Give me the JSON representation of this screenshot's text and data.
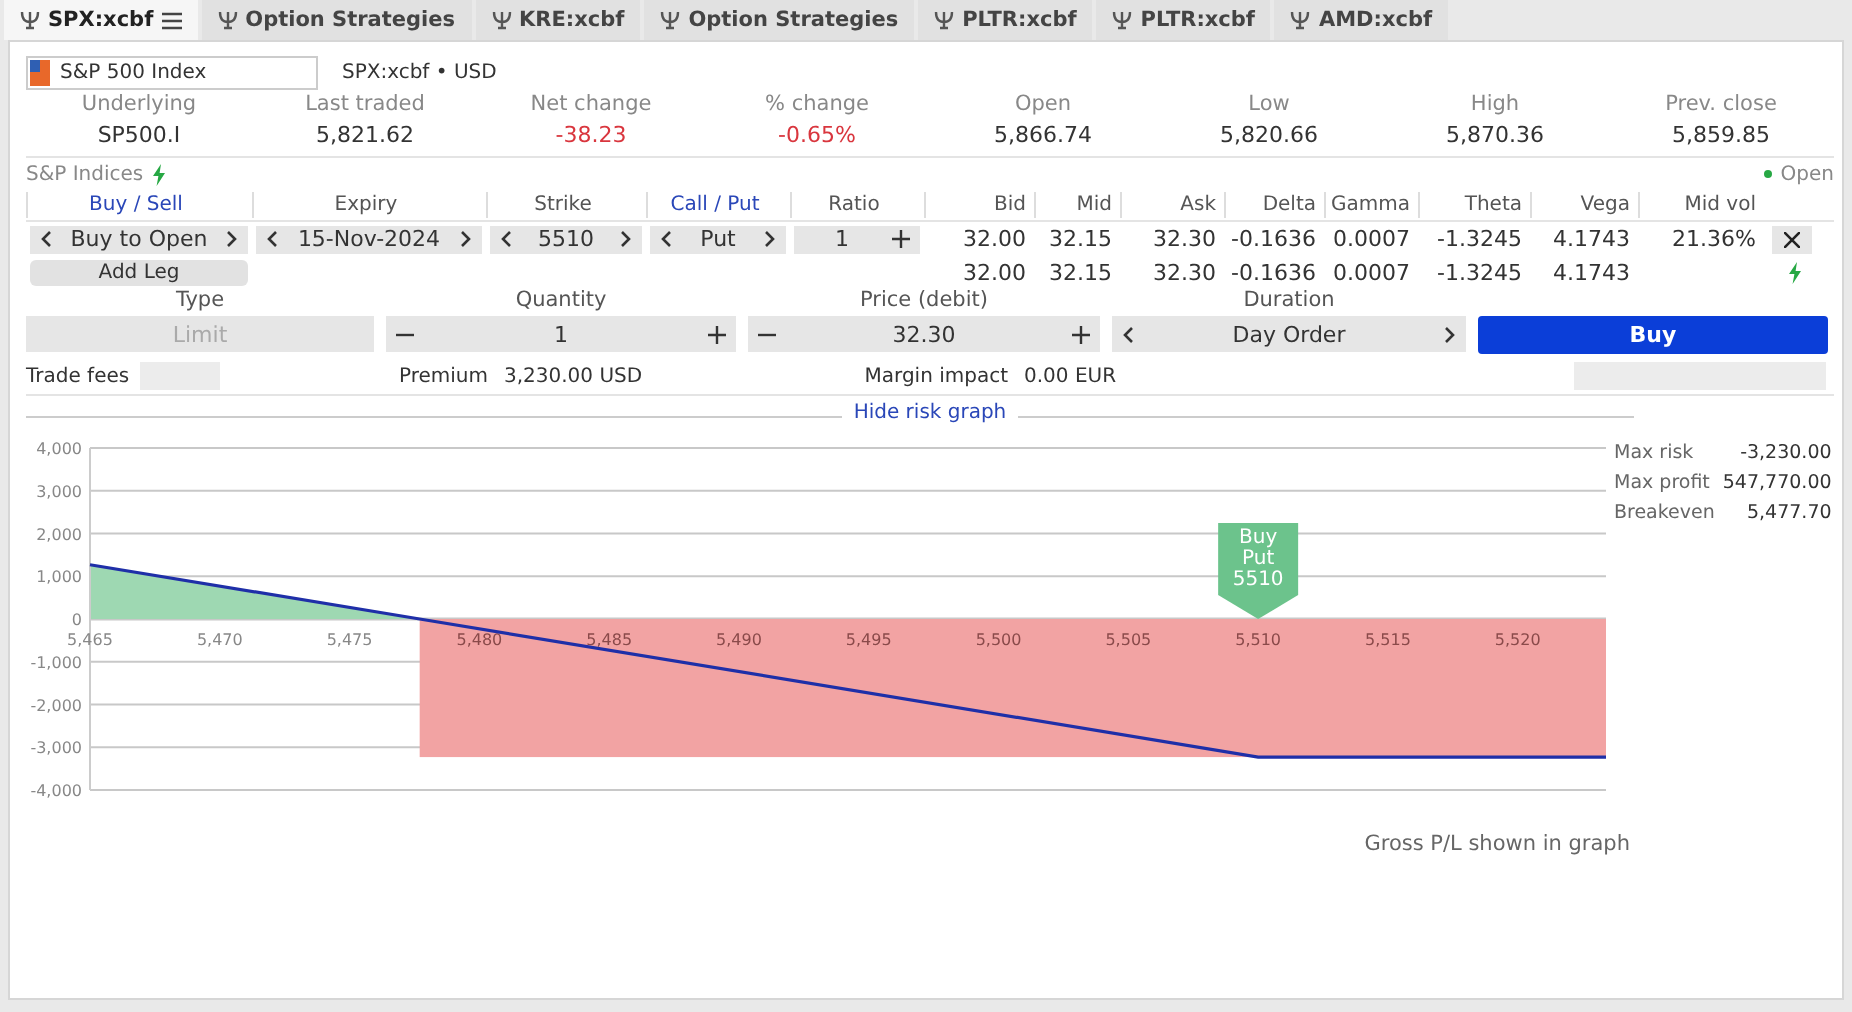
{
  "tabs": [
    {
      "label": "SPX:xcbf",
      "selected": true,
      "menu": true
    },
    {
      "label": "Option Strategies",
      "selected": false,
      "menu": false
    },
    {
      "label": "KRE:xcbf",
      "selected": false,
      "menu": false
    },
    {
      "label": "Option Strategies",
      "selected": false,
      "menu": false
    },
    {
      "label": "PLTR:xcbf",
      "selected": false,
      "menu": false
    },
    {
      "label": "PLTR:xcbf",
      "selected": false,
      "menu": false
    },
    {
      "label": "AMD:xcbf",
      "selected": false,
      "menu": false
    }
  ],
  "instrument": {
    "name": "S&P 500 Index",
    "subtitle": "SPX:xcbf • USD"
  },
  "quote": [
    {
      "label": "Underlying",
      "value": "SP500.I",
      "negative": false
    },
    {
      "label": "Last traded",
      "value": "5,821.62",
      "negative": false
    },
    {
      "label": "Net change",
      "value": "-38.23",
      "negative": true
    },
    {
      "label": "% change",
      "value": "-0.65%",
      "negative": true
    },
    {
      "label": "Open",
      "value": "5,866.74",
      "negative": false
    },
    {
      "label": "Low",
      "value": "5,820.66",
      "negative": false
    },
    {
      "label": "High",
      "value": "5,870.36",
      "negative": false
    },
    {
      "label": "Prev. close",
      "value": "5,859.85",
      "negative": false
    }
  ],
  "market": {
    "group": "S&P Indices",
    "status": "Open"
  },
  "legs_header": [
    {
      "label": "Buy / Sell",
      "kind": "link"
    },
    {
      "label": "Expiry",
      "kind": "plain"
    },
    {
      "label": "Strike",
      "kind": "plain"
    },
    {
      "label": "Call / Put",
      "kind": "link"
    },
    {
      "label": "Ratio",
      "kind": "plain"
    },
    {
      "label": "Bid",
      "kind": "plain"
    },
    {
      "label": "Mid",
      "kind": "plain"
    },
    {
      "label": "Ask",
      "kind": "plain"
    },
    {
      "label": "Delta",
      "kind": "plain"
    },
    {
      "label": "Gamma",
      "kind": "plain"
    },
    {
      "label": "Theta",
      "kind": "plain"
    },
    {
      "label": "Vega",
      "kind": "plain"
    },
    {
      "label": "Mid vol",
      "kind": "plain"
    }
  ],
  "leg": {
    "action": "Buy to Open",
    "expiry": "15-Nov-2024",
    "strike": "5510",
    "right": "Put",
    "ratio": "1",
    "quotes": [
      "32.00",
      "32.15",
      "32.30",
      "-0.1636",
      "0.0007",
      "-1.3245",
      "4.1743",
      "21.36%"
    ]
  },
  "add_leg": "Add Leg",
  "totals": [
    "32.00",
    "32.15",
    "32.30",
    "-0.1636",
    "0.0007",
    "-1.3245",
    "4.1743"
  ],
  "order": {
    "type_label": "Type",
    "type": "Limit",
    "type_disabled": true,
    "quantity_label": "Quantity",
    "quantity": "1",
    "price_label": "Price (debit)",
    "price": "32.30",
    "duration_label": "Duration",
    "duration": "Day Order",
    "submit": "Buy"
  },
  "fees": {
    "trade_fees": "Trade fees",
    "premium_label": "Premium",
    "premium": "3,230.00 USD",
    "margin_label": "Margin impact",
    "margin": "0.00 EUR"
  },
  "hide_graph": "Hide risk graph",
  "risk_graph": {
    "chart_data": {
      "type": "line",
      "grid": true,
      "xlim": [
        5465,
        5523.4
      ],
      "ylim": [
        -4000,
        4000
      ],
      "xticks": [
        {
          "value": 5465,
          "label": "5,465"
        },
        {
          "value": 5470,
          "label": "5,470"
        },
        {
          "value": 5475,
          "label": "5,475"
        },
        {
          "value": 5480,
          "label": "5,480"
        },
        {
          "value": 5485,
          "label": "5,485"
        },
        {
          "value": 5490,
          "label": "5,490"
        },
        {
          "value": 5495,
          "label": "5,495"
        },
        {
          "value": 5500,
          "label": "5,500"
        },
        {
          "value": 5505,
          "label": "5,505"
        },
        {
          "value": 5510,
          "label": "5,510"
        },
        {
          "value": 5515,
          "label": "5,515"
        },
        {
          "value": 5520,
          "label": "5,520"
        }
      ],
      "yticks": [
        {
          "value": 4000,
          "label": "4,000"
        },
        {
          "value": 3000,
          "label": "3,000"
        },
        {
          "value": 2000,
          "label": "2,000"
        },
        {
          "value": 1000,
          "label": "1,000"
        },
        {
          "value": 0,
          "label": "0"
        },
        {
          "value": -1000,
          "label": "-1,000"
        },
        {
          "value": -2000,
          "label": "-2,000"
        },
        {
          "value": -3000,
          "label": "-3,000"
        },
        {
          "value": -4000,
          "label": "-4,000"
        }
      ],
      "x": [
        5465,
        5477.7,
        5510,
        5523.4
      ],
      "series": [
        {
          "color": "#1f2fa8",
          "values": [
            1270,
            0,
            -3230,
            -3230
          ]
        }
      ],
      "annotations": [
        "Buy\nPut\n5510"
      ]
    },
    "stats": [
      {
        "label": "Max risk",
        "value": "-3,230.00"
      },
      {
        "label": "Max profit",
        "value": "547,770.00"
      },
      {
        "label": "Breakeven",
        "value": "5,477.70"
      }
    ],
    "footnote": "Gross P/L shown in graph"
  }
}
